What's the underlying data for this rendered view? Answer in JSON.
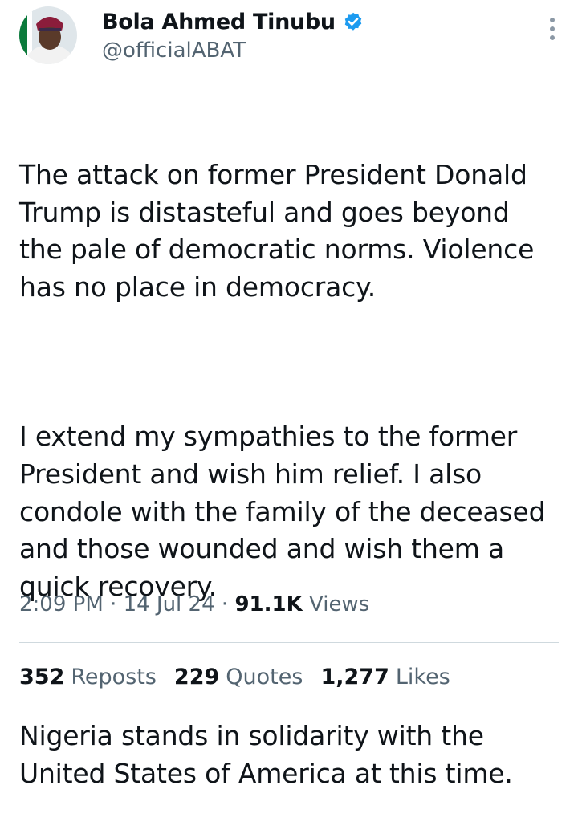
{
  "user": {
    "display_name": "Bola Ahmed Tinubu",
    "handle": "@officialABAT",
    "verified": true,
    "avatar_icon": "profile-photo"
  },
  "tweet": {
    "paragraphs": [
      "The attack on former President Donald\nTrump is distasteful and goes beyond\nthe pale of democratic norms. Violence\nhas no place in democracy.",
      "I extend my sympathies to the former\nPresident and wish him relief. I also\ncondole with the family of the deceased\nand those wounded and wish them a\nquick recovery.",
      "Nigeria stands in solidarity with the\nUnited States of America at this time."
    ]
  },
  "meta": {
    "time": "2:09 PM",
    "separator": "·",
    "date": "14 Jul 24",
    "views_count": "91.1K",
    "views_label": "Views"
  },
  "stats": {
    "reposts_count": "352",
    "reposts_label": "Reposts",
    "quotes_count": "229",
    "quotes_label": "Quotes",
    "likes_count": "1,277",
    "likes_label": "Likes"
  },
  "colors": {
    "primary_text": "#0f1419",
    "secondary_text": "#536471",
    "verified_blue": "#1d9bf0",
    "divider": "#cfd9de"
  }
}
